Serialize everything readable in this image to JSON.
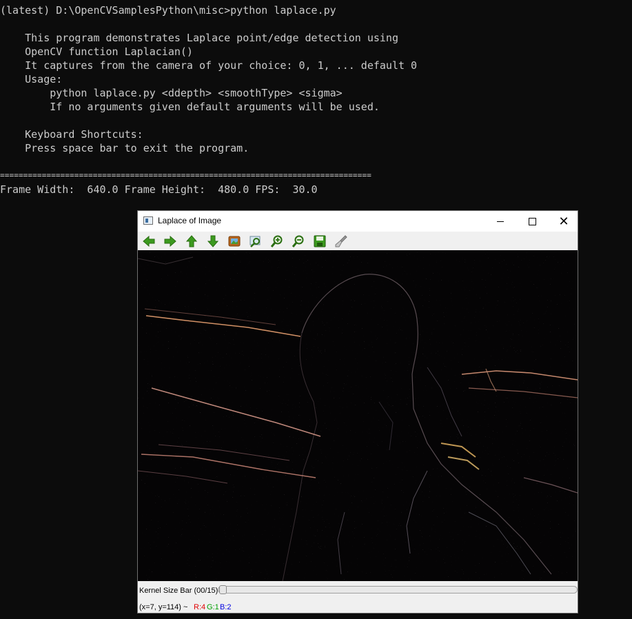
{
  "console": {
    "lines": [
      "(latest) D:\\OpenCVSamplesPython\\misc>python laplace.py",
      "    This program demonstrates Laplace point/edge detection using",
      "    OpenCV function Laplacian()",
      "    It captures from the camera of your choice: 0, 1, ... default 0",
      "    Usage:",
      "        python laplace.py <ddepth> <smoothType> <sigma>",
      "        If no arguments given default arguments will be used.",
      "    Keyboard Shortcuts:",
      "    Press space bar to exit the program.",
      "================================================================================",
      "Frame Width:  640.0 Frame Height:  480.0 FPS:  30.0"
    ]
  },
  "window": {
    "title": "Laplace of Image",
    "minimize_icon": "minimize-icon",
    "maximize_icon": "maximize-icon",
    "close_glyph": "✕"
  },
  "toolbar": {
    "buttons": [
      {
        "icon": "arrow-left-icon"
      },
      {
        "icon": "arrow-right-icon"
      },
      {
        "icon": "arrow-up-icon"
      },
      {
        "icon": "arrow-down-icon"
      },
      {
        "icon": "zoom-fit-icon"
      },
      {
        "icon": "zoom-original-icon"
      },
      {
        "icon": "zoom-in-icon"
      },
      {
        "icon": "zoom-out-icon"
      },
      {
        "icon": "save-icon"
      },
      {
        "icon": "properties-icon"
      }
    ]
  },
  "trackbar": {
    "label": "Kernel Size Bar (00/15)",
    "value": 0,
    "max": 15
  },
  "status": {
    "coords": "(x=7, y=114) ~",
    "r": "R:4",
    "g": "G:1",
    "b": "B:2",
    "colors": {
      "r": "#e00000",
      "g": "#00a000",
      "b": "#0000e0"
    }
  },
  "colors": {
    "console_bg": "#0c0c0c",
    "console_text": "#cccccc",
    "toolbar_green": "#3c9a1f",
    "edge_warm": "#e8a070"
  }
}
